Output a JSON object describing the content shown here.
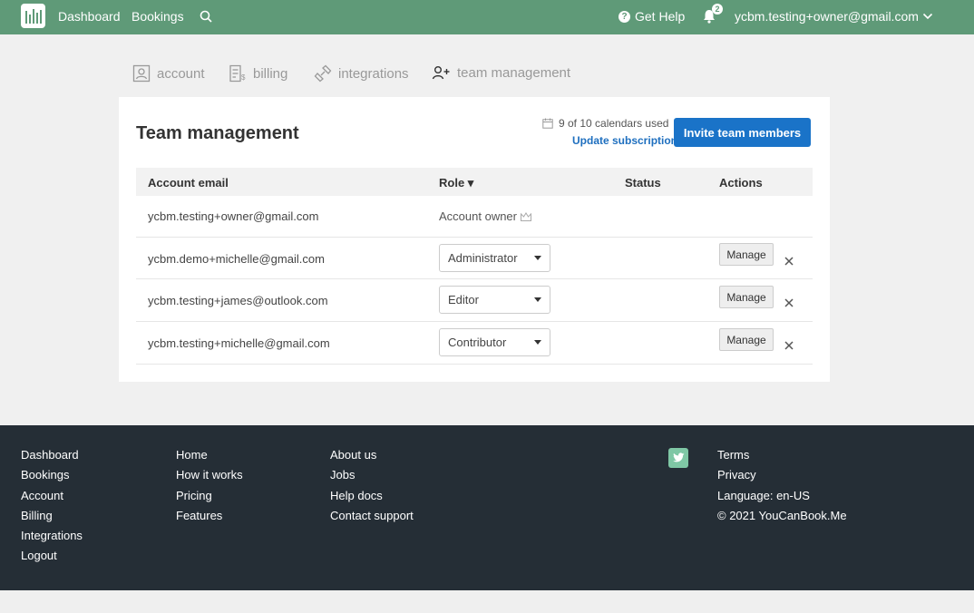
{
  "nav": {
    "links": [
      "Dashboard",
      "Bookings"
    ],
    "help_label": "Get Help",
    "notification_count": "2",
    "user_email": "ycbm.testing+owner@gmail.com"
  },
  "tabs": [
    {
      "label": "account",
      "icon": "account-icon",
      "active": false
    },
    {
      "label": "billing",
      "icon": "billing-icon",
      "active": false
    },
    {
      "label": "integrations",
      "icon": "integrations-icon",
      "active": false
    },
    {
      "label": "team management",
      "icon": "add-user-icon",
      "active": true
    }
  ],
  "card": {
    "title": "Team management",
    "usage_text": "9 of 10 calendars used",
    "update_link": "Update subscription",
    "invite_label": "Invite team members"
  },
  "table": {
    "headers": [
      "Account email",
      "Role ▾",
      "Status",
      "Actions"
    ],
    "rows": [
      {
        "email": "ycbm.testing+owner@gmail.com",
        "role": "Account owner",
        "editable": false
      },
      {
        "email": "ycbm.demo+michelle@gmail.com",
        "role": "Administrator",
        "editable": true,
        "action": "Manage"
      },
      {
        "email": "ycbm.testing+james@outlook.com",
        "role": "Editor",
        "editable": true,
        "action": "Manage"
      },
      {
        "email": "ycbm.testing+michelle@gmail.com",
        "role": "Contributor",
        "editable": true,
        "action": "Manage"
      }
    ]
  },
  "footer": {
    "col1": [
      "Dashboard",
      "Bookings",
      "Account",
      "Billing",
      "Integrations",
      "Logout"
    ],
    "col2": [
      "Home",
      "How it works",
      "Pricing",
      "Features"
    ],
    "col3": [
      "About us",
      "Jobs",
      "Help docs",
      "Contact support"
    ],
    "col4": [
      "Terms",
      "Privacy",
      "Language: en-US",
      "© 2021 YouCanBook.Me"
    ]
  },
  "colors": {
    "nav_bg": "#5f9a78",
    "primary_button": "#1a73c8",
    "footer_bg": "#252e36"
  }
}
